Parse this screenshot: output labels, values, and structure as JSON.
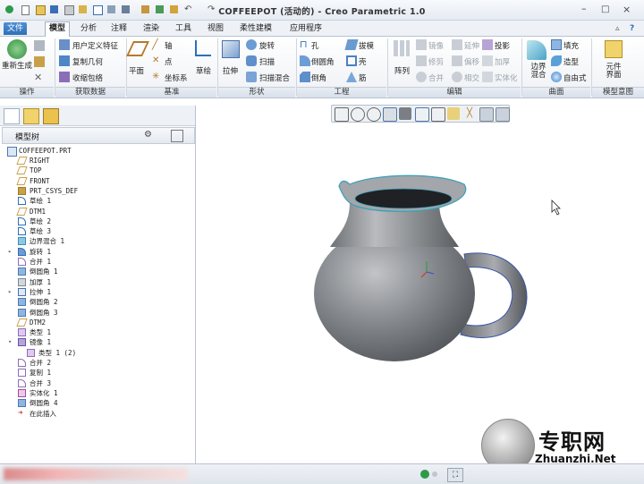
{
  "window": {
    "title": "COFFEEPOT (活动的) - Creo Parametric 1.0"
  },
  "menu_tabs": [
    "文件",
    "模型",
    "分析",
    "注释",
    "渲染",
    "工具",
    "视图",
    "柔性建模",
    "应用程序"
  ],
  "ribbon": {
    "groups": {
      "operations": "操作",
      "get_data": "获取数据",
      "datum": "基准",
      "shapes": "形状",
      "engineering": "工程",
      "editing": "编辑",
      "surfaces": "曲面",
      "model_intent": "模型意图"
    },
    "buttons": {
      "regenerate": "重新生成",
      "user_defined_feature": "用户定义特征",
      "copy_geometry": "复制几何",
      "shrinkwrap": "收缩包络",
      "plane": "平面",
      "axis": "轴",
      "point": "点",
      "coord_sys": "坐标系",
      "sketch": "草绘",
      "extrude": "拉伸",
      "revolve": "旋转",
      "sweep": "扫描",
      "swept_blend": "扫描混合",
      "hole": "孔",
      "draft": "拔模",
      "round": "倒圆角",
      "shell": "壳",
      "chamfer": "倒角",
      "rib": "筋",
      "pattern": "阵列",
      "mirror": "镜像",
      "extend": "延伸",
      "project": "投影",
      "trim": "修剪",
      "offset": "偏移",
      "thicken": "加厚",
      "merge": "合并",
      "intersect": "相交",
      "solidify": "实体化",
      "boundary_blend": "边界混合",
      "fill": "填充",
      "style": "造型",
      "freestyle": "自由式",
      "component_interface": "元件界面"
    }
  },
  "model_tree": {
    "title": "模型树",
    "root": "COFFEEPOT.PRT",
    "items": [
      "RIGHT",
      "TOP",
      "FRONT",
      "PRT_CSYS_DEF",
      "草绘 1",
      "DTM1",
      "草绘 2",
      "草绘 3",
      "边界混合 1",
      "旋转 1",
      "合并 1",
      "倒圆角 1",
      "加厚 1",
      "拉伸 1",
      "倒圆角 2",
      "倒圆角 3",
      "DTM2",
      "类型 1",
      "镜像 1",
      "类型 1 (2)",
      "合并 2",
      "复制 1",
      "合并 3",
      "实体化 1",
      "倒圆角 4",
      "在此插入"
    ]
  },
  "watermark": {
    "text": "专职网",
    "url": "Zhuanzhi.Net"
  },
  "colors": {
    "accent": "#2f6fb8",
    "model": "#7f8184",
    "edge": "#3aa0b8"
  }
}
